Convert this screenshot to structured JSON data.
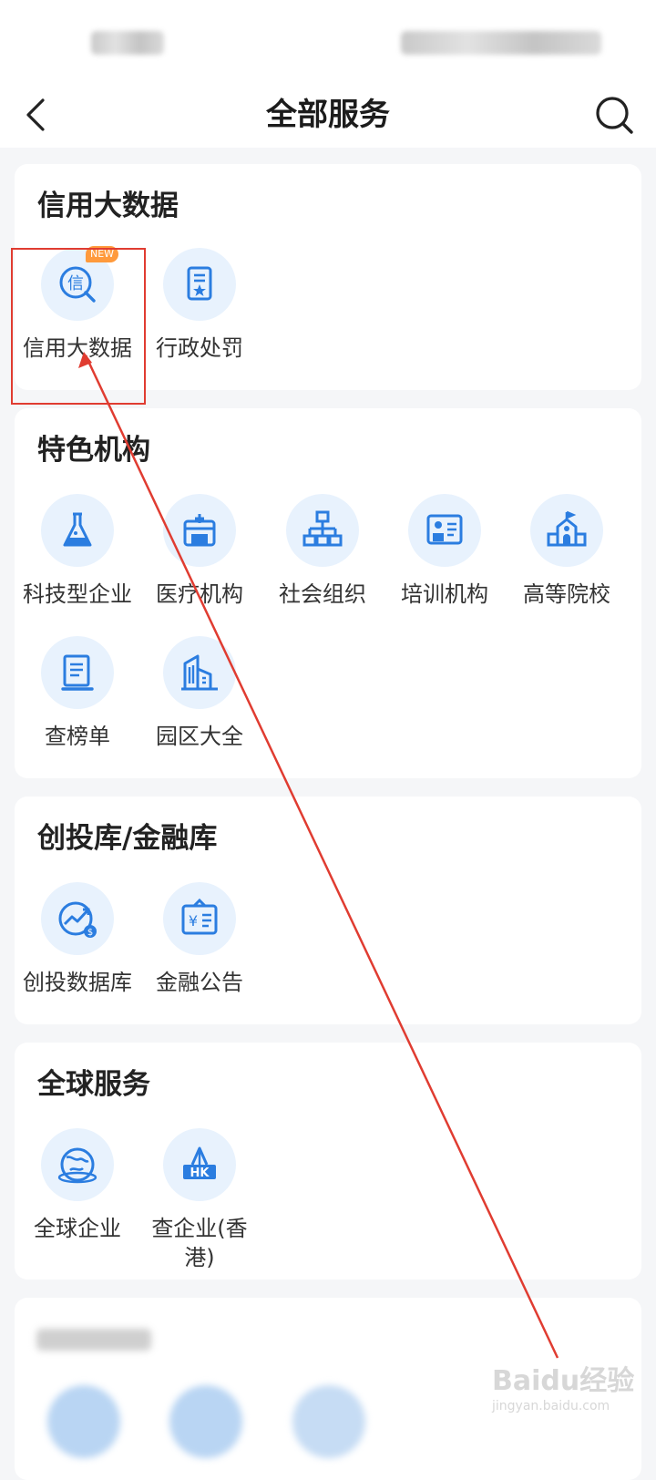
{
  "header": {
    "title": "全部服务"
  },
  "sections": [
    {
      "title": "信用大数据",
      "items": [
        {
          "label": "信用大数据",
          "icon": "credit-search-icon",
          "badge": "NEW"
        },
        {
          "label": "行政处罚",
          "icon": "penalty-document-icon"
        }
      ]
    },
    {
      "title": "特色机构",
      "items": [
        {
          "label": "科技型企业",
          "icon": "flask-icon"
        },
        {
          "label": "医疗机构",
          "icon": "hospital-icon"
        },
        {
          "label": "社会组织",
          "icon": "org-chart-icon"
        },
        {
          "label": "培训机构",
          "icon": "training-board-icon"
        },
        {
          "label": "高等院校",
          "icon": "university-icon"
        },
        {
          "label": "查榜单",
          "icon": "ranking-list-icon"
        },
        {
          "label": "园区大全",
          "icon": "buildings-icon"
        }
      ]
    },
    {
      "title": "创投库/金融库",
      "items": [
        {
          "label": "创投数据库",
          "icon": "growth-chart-icon"
        },
        {
          "label": "金融公告",
          "icon": "finance-notice-icon"
        }
      ]
    },
    {
      "title": "全球服务",
      "items": [
        {
          "label": "全球企业",
          "icon": "globe-icon"
        },
        {
          "label": "查企业(香港)",
          "icon": "hk-building-icon"
        }
      ]
    }
  ],
  "watermark": {
    "brand": "Baidu经验",
    "url": "jingyan.baidu.com"
  },
  "colors": {
    "icon_bg": "#e8f2fd",
    "icon_fg": "#2b7de0",
    "annotation": "#e03c31",
    "badge": "#ff9a3c"
  }
}
